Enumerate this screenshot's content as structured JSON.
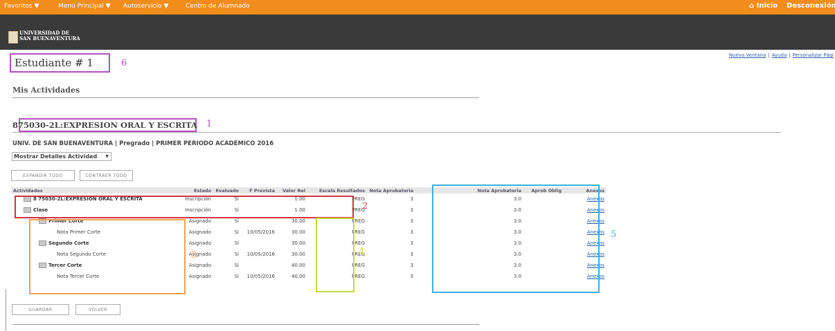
{
  "topbar": {
    "menus": [
      {
        "label": "Favoritos ▼"
      },
      {
        "label": "Menú Principal ▼"
      },
      {
        "label": "Autoservicio ▼"
      },
      {
        "label": "Centro de Alumnado"
      }
    ],
    "home_label": "Inicio",
    "logout_label": "Desconexión"
  },
  "brand": {
    "line1": "UNIVERSIDAD DE",
    "line2": "SAN BUENAVENTURA"
  },
  "links": {
    "new_window": "Nueva Ventana",
    "help": "Ayuda",
    "customize": "Personalizar Pági"
  },
  "page": {
    "student": "Estudiante # 1",
    "section": "Mis Actividades",
    "course_title": "875030-2L:EXPRESION ORAL Y ESCRITA",
    "course_info": "UNIV. DE SAN BUENAVENTURA | Pregrado | PRIMER PERIODO ACADÉMICO 2016",
    "detail_select": "Mostrar Detalles Actividad"
  },
  "annotations": {
    "a1": "1",
    "a2": "2",
    "a3": "3",
    "a4": "4",
    "a5": "5",
    "a6": "6"
  },
  "buttons": {
    "expand": "Expandir Todo",
    "collapse": "Contraer Todo",
    "save": "Guardar",
    "back": "Volver"
  },
  "table": {
    "headers": [
      "Actividades",
      "Estado",
      "Evaluado",
      "F Prevista",
      "Valor Rel",
      "Escala Resultados",
      "Nota Aprobatoria",
      "Nota Aprobatoria",
      "Aprob Oblig",
      "Anexos"
    ],
    "rows": [
      {
        "activity": "8 75030-2L:EXPRESION ORAL Y ESCRITA",
        "status": "Inscripción",
        "evaluated": "Sí",
        "date": "",
        "value": "1.00",
        "scale": "PREG",
        "grade1": "3",
        "grade2": "3.0",
        "link": "Anexos"
      },
      {
        "activity": "Clase",
        "status": "Inscripción",
        "evaluated": "Sí",
        "date": "",
        "value": "1.00",
        "scale": "PREG",
        "grade1": "3",
        "grade2": "3.0",
        "link": "Anexos"
      },
      {
        "activity": "Primer Corte",
        "status": "Asignado",
        "evaluated": "Sí",
        "date": "",
        "value": "30.00",
        "scale": "PREG",
        "grade1": "3",
        "grade2": "3.0",
        "link": "Anexos"
      },
      {
        "activity": "Nota Primer Corte",
        "status": "Asignado",
        "evaluated": "Sí",
        "date": "10/05/2016",
        "value": "30.00",
        "scale": "PREG",
        "grade1": "3",
        "grade2": "3.0",
        "link": "Anexos"
      },
      {
        "activity": "Segundo Corte",
        "status": "Asignado",
        "evaluated": "Sí",
        "date": "",
        "value": "30.00",
        "scale": "PREG",
        "grade1": "3",
        "grade2": "3.0",
        "link": "Anexos"
      },
      {
        "activity": "Nota Segundo Corte",
        "status": "Asignado",
        "evaluated": "Sí",
        "date": "10/05/2016",
        "value": "30.00",
        "scale": "PREG",
        "grade1": "3",
        "grade2": "3.0",
        "link": "Anexos"
      },
      {
        "activity": "Tercer Corte",
        "status": "Asignado",
        "evaluated": "Sí",
        "date": "",
        "value": "40.00",
        "scale": "PREG",
        "grade1": "3",
        "grade2": "3.0",
        "link": "Anexos"
      },
      {
        "activity": "Nota Tercer Corte",
        "status": "Asignado",
        "evaluated": "Sí",
        "date": "10/05/2016",
        "value": "40.00",
        "scale": "PREG",
        "grade1": "3",
        "grade2": "3.0",
        "link": "Anexos"
      }
    ]
  },
  "colors": {
    "topbar": "#f28c1a",
    "banner": "#3a3a3a",
    "box1": "#b44fc0",
    "box2": "#cc3344",
    "box3": "#f0a050",
    "box4": "#c8d840",
    "box5": "#3ab0e0"
  }
}
